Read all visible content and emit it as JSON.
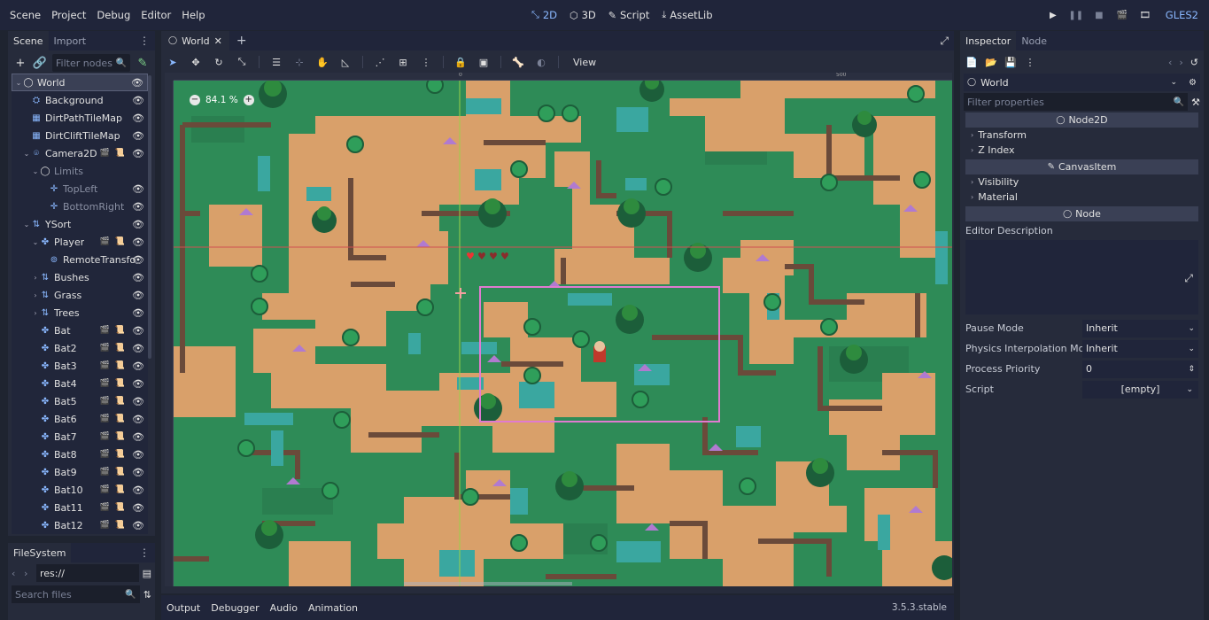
{
  "menu": [
    "Scene",
    "Project",
    "Debug",
    "Editor",
    "Help"
  ],
  "modes": [
    {
      "label": "2D",
      "icon": "2d-icon",
      "active": true
    },
    {
      "label": "3D",
      "icon": "3d-icon",
      "active": false
    },
    {
      "label": "Script",
      "icon": "script-icon",
      "active": false
    },
    {
      "label": "AssetLib",
      "icon": "assetlib-icon",
      "active": false
    }
  ],
  "renderer": "GLES2",
  "scene_dock": {
    "tabs": [
      "Scene",
      "Import"
    ],
    "filter_placeholder": "Filter nodes",
    "tree": [
      {
        "label": "World",
        "depth": 0,
        "arrow": "down",
        "icon": "node2d-icon",
        "selected": true
      },
      {
        "label": "Background",
        "depth": 1,
        "icon": "sprite-icon"
      },
      {
        "label": "DirtPathTileMap",
        "depth": 1,
        "icon": "tilemap-icon"
      },
      {
        "label": "DirtCliftTileMap",
        "depth": 1,
        "icon": "tilemap-icon"
      },
      {
        "label": "Camera2D",
        "depth": 1,
        "arrow": "down",
        "icon": "camera-icon",
        "extras": true
      },
      {
        "label": "Limits",
        "depth": 2,
        "arrow": "down",
        "icon": "node2d-icon",
        "dim": true
      },
      {
        "label": "TopLeft",
        "depth": 3,
        "icon": "position-icon",
        "dim": true
      },
      {
        "label": "BottomRight",
        "depth": 3,
        "icon": "position-icon",
        "dim": true
      },
      {
        "label": "YSort",
        "depth": 1,
        "arrow": "down",
        "icon": "ysort-icon"
      },
      {
        "label": "Player",
        "depth": 2,
        "arrow": "down",
        "icon": "kinematic-icon",
        "extras": true
      },
      {
        "label": "RemoteTransfo",
        "depth": 3,
        "icon": "remote-icon"
      },
      {
        "label": "Bushes",
        "depth": 2,
        "arrow": "right",
        "icon": "ysort-icon"
      },
      {
        "label": "Grass",
        "depth": 2,
        "arrow": "right",
        "icon": "ysort-icon"
      },
      {
        "label": "Trees",
        "depth": 2,
        "arrow": "right",
        "icon": "ysort-icon"
      },
      {
        "label": "Bat",
        "depth": 2,
        "icon": "kinematic-icon",
        "extras": true
      },
      {
        "label": "Bat2",
        "depth": 2,
        "icon": "kinematic-icon",
        "extras": true
      },
      {
        "label": "Bat3",
        "depth": 2,
        "icon": "kinematic-icon",
        "extras": true
      },
      {
        "label": "Bat4",
        "depth": 2,
        "icon": "kinematic-icon",
        "extras": true
      },
      {
        "label": "Bat5",
        "depth": 2,
        "icon": "kinematic-icon",
        "extras": true
      },
      {
        "label": "Bat6",
        "depth": 2,
        "icon": "kinematic-icon",
        "extras": true
      },
      {
        "label": "Bat7",
        "depth": 2,
        "icon": "kinematic-icon",
        "extras": true
      },
      {
        "label": "Bat8",
        "depth": 2,
        "icon": "kinematic-icon",
        "extras": true
      },
      {
        "label": "Bat9",
        "depth": 2,
        "icon": "kinematic-icon",
        "extras": true
      },
      {
        "label": "Bat10",
        "depth": 2,
        "icon": "kinematic-icon",
        "extras": true
      },
      {
        "label": "Bat11",
        "depth": 2,
        "icon": "kinematic-icon",
        "extras": true
      },
      {
        "label": "Bat12",
        "depth": 2,
        "icon": "kinematic-icon",
        "extras": true
      }
    ]
  },
  "filesystem": {
    "tab": "FileSystem",
    "path": "res://",
    "search_placeholder": "Search files"
  },
  "viewport": {
    "tab": "World",
    "zoom": "84.1 %",
    "view_menu": "View",
    "ruler_marks": [
      "0",
      "500"
    ]
  },
  "bottom": {
    "tabs": [
      "Output",
      "Debugger",
      "Audio",
      "Animation"
    ],
    "version": "3.5.3.stable"
  },
  "inspector": {
    "tabs": [
      "Inspector",
      "Node"
    ],
    "object": "World",
    "filter_placeholder": "Filter properties",
    "categories": {
      "node2d": "Node2D",
      "canvasitem": "CanvasItem",
      "node": "Node"
    },
    "sections": {
      "transform": "Transform",
      "zindex": "Z Index",
      "visibility": "Visibility",
      "material": "Material"
    },
    "editor_description": "Editor Description",
    "props": [
      {
        "label": "Pause Mode",
        "value": "Inherit",
        "kind": "select"
      },
      {
        "label": "Physics Interpolation Mod",
        "value": "Inherit",
        "kind": "select"
      },
      {
        "label": "Process Priority",
        "value": "0",
        "kind": "spin"
      },
      {
        "label": "Script",
        "value": "[empty]",
        "kind": "resource"
      }
    ]
  },
  "colors": {
    "accent": "#8ab8ff",
    "grass": "#2a8a5a",
    "dirt": "#d9a06a",
    "cliff": "#6a4a3a"
  }
}
